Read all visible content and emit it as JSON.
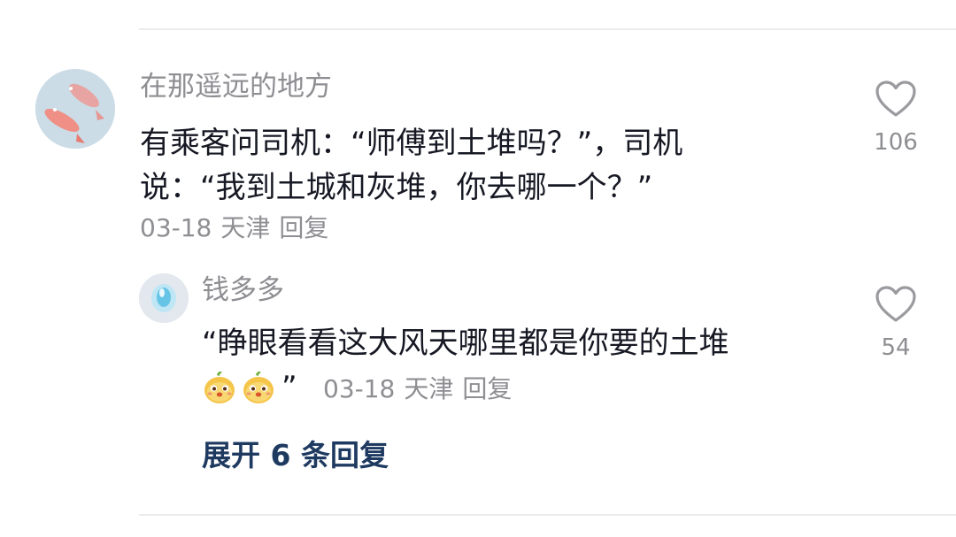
{
  "comment": {
    "username": "在那遥远的地方",
    "text_line1": "有乘客问司机：“师傅到土堆吗？”，司机",
    "text_line2": "说：“我到土城和灰堆，你去哪一个？”",
    "date": "03-18",
    "location": "天津",
    "reply_label": "回复",
    "like_count": "106"
  },
  "reply": {
    "username": "钱多多",
    "text_line1": "“睁眼看看这大风天哪里都是你要的土堆",
    "emoji_icons": [
      "cartoon-face-emoji",
      "cartoon-face-emoji"
    ],
    "close_quote": "”",
    "date": "03-18",
    "location": "天津",
    "reply_label": "回复",
    "like_count": "54"
  },
  "expand_label": "展开 6 条回复",
  "colors": {
    "text": "#161823",
    "secondary": "#8e8e93",
    "expand": "#1f3a61"
  }
}
